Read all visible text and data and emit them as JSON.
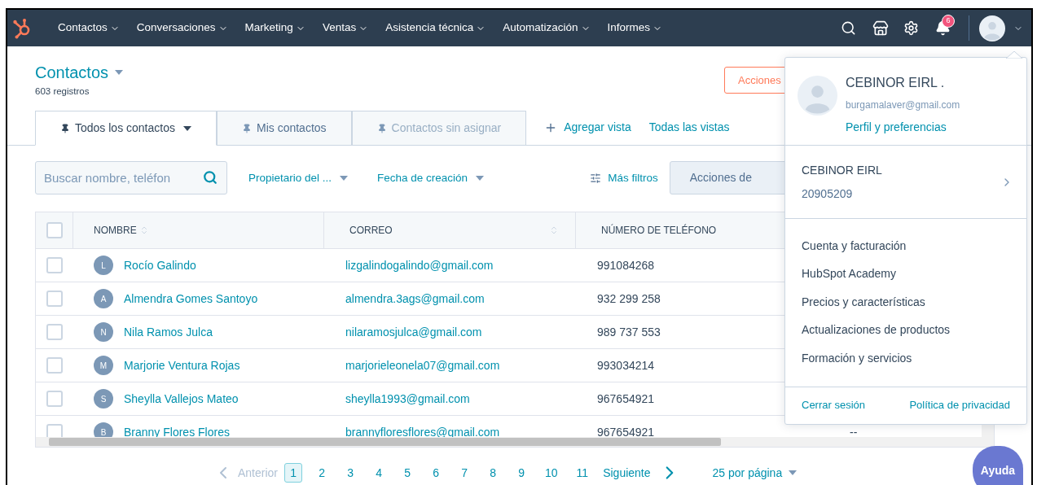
{
  "nav": {
    "items": [
      "Contactos",
      "Conversaciones",
      "Marketing",
      "Ventas",
      "Asistencia técnica",
      "Automatización",
      "Informes"
    ],
    "notification_count": "6"
  },
  "page": {
    "title": "Contactos",
    "record_count": "603 registros",
    "header_button": "Acciones"
  },
  "tabs": [
    {
      "label": "Todos los contactos",
      "selected": true,
      "greyed": false
    },
    {
      "label": "Mis contactos",
      "selected": false,
      "greyed": false
    },
    {
      "label": "Contactos sin asignar",
      "selected": false,
      "greyed": true
    }
  ],
  "view_links": [
    {
      "kind": "add",
      "label": "Agregar vista"
    },
    {
      "kind": "plain",
      "label": "Todas las vistas"
    }
  ],
  "filters": {
    "search_placeholder": "Buscar nombre, teléfon",
    "dropdowns": [
      "Propietario del ...",
      "Fecha de creación"
    ],
    "more_filters": "Más filtros",
    "actions": "Acciones de"
  },
  "table": {
    "header_checked": false,
    "columns": [
      {
        "label": "NOMBRE",
        "sortable": true
      },
      {
        "label": "CORREO",
        "sortable": true
      },
      {
        "label": "NÚMERO DE TELÉFONO",
        "sortable": false
      }
    ],
    "rows": [
      {
        "checked": false,
        "initial": "L",
        "name": "Rocío Galindo",
        "email": "lizgalindogalindo@gmail.com",
        "phone": "991084268"
      },
      {
        "checked": false,
        "initial": "A",
        "name": "Almendra Gomes Santoyo",
        "email": "almendra.3ags@gmail.com",
        "phone": "932 299 258"
      },
      {
        "checked": false,
        "initial": "N",
        "name": "Nila Ramos Julca",
        "email": "nilaramosjulca@gmail.com",
        "phone": "989 737 553"
      },
      {
        "checked": false,
        "initial": "M",
        "name": "Marjorie Ventura Rojas",
        "email": "marjorieleonela07@gmail.com",
        "phone": "993034214"
      },
      {
        "checked": false,
        "initial": "S",
        "name": "Sheylla Vallejos Mateo",
        "email": "sheylla1993@gmail.com",
        "phone": "967654921"
      },
      {
        "checked": false,
        "initial": "B",
        "name": "Branny Flores Flores",
        "email": "brannyfloresflores@gmail.com",
        "phone": "967654921",
        "column_4": "--"
      }
    ]
  },
  "pagination": {
    "previous": "Anterior",
    "pages": [
      {
        "label": "1",
        "selected": true
      },
      {
        "label": "2",
        "selected": false
      },
      {
        "label": "3",
        "selected": false
      },
      {
        "label": "4",
        "selected": false
      },
      {
        "label": "5",
        "selected": false
      },
      {
        "label": "6",
        "selected": false
      },
      {
        "label": "7",
        "selected": false
      },
      {
        "label": "8",
        "selected": false
      },
      {
        "label": "9",
        "selected": false
      },
      {
        "label": "10",
        "selected": false
      },
      {
        "label": "11",
        "selected": false
      }
    ],
    "next": "Siguiente",
    "per_page": "25 por página"
  },
  "account_menu": {
    "name": "CEBINOR EIRL .",
    "email": "burgamalaver@gmail.com",
    "profile_link": "Perfil y preferencias",
    "account": {
      "name": "CEBINOR EIRL",
      "id": "20905209"
    },
    "items": [
      "Cuenta y facturación",
      "HubSpot Academy",
      "Precios y características",
      "Actualizaciones de productos",
      "Formación y servicios"
    ],
    "footer_links": [
      "Cerrar sesión",
      "Política de privacidad"
    ]
  },
  "help_button": "Ayuda"
}
